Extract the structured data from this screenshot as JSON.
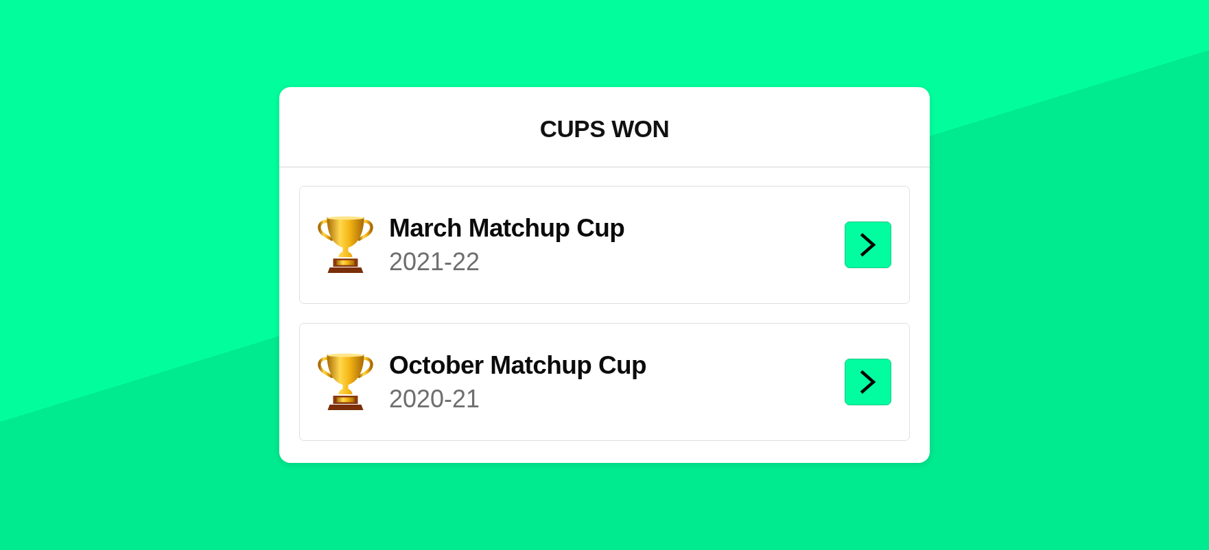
{
  "panel": {
    "title": "CUPS WON",
    "cups": [
      {
        "name": "March Matchup Cup",
        "season": "2021-22"
      },
      {
        "name": "October Matchup Cup",
        "season": "2020-21"
      }
    ]
  }
}
